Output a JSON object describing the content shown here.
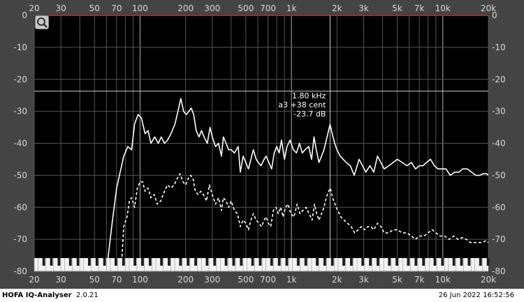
{
  "app": {
    "name": "HOFA IQ-Analyser",
    "version": "2.0.21",
    "timestamp": "26 Jun 2022 16:52:56"
  },
  "icons": {
    "zoom": "magnifier-icon"
  },
  "colors": {
    "background": "#000000",
    "frame": "#444444",
    "grid": "#7a7a7a",
    "curve": "#ffffff",
    "redline": "#cc2222"
  },
  "cursor": {
    "freq": "1.80 kHz",
    "note": "a3 +38 cent",
    "level": "-23.7 dB",
    "freq_hz": 1800,
    "level_db": -23.7
  },
  "chart_data": {
    "type": "line",
    "x_scale": "log",
    "xlim": [
      20,
      20000
    ],
    "ylim": [
      -80,
      0
    ],
    "x_ticks": [
      {
        "v": 20,
        "label": "20"
      },
      {
        "v": 30,
        "label": "30"
      },
      {
        "v": 50,
        "label": "50"
      },
      {
        "v": 70,
        "label": "70"
      },
      {
        "v": 100,
        "label": "100"
      },
      {
        "v": 200,
        "label": "200"
      },
      {
        "v": 300,
        "label": "300"
      },
      {
        "v": 500,
        "label": "500"
      },
      {
        "v": 700,
        "label": "700"
      },
      {
        "v": 1000,
        "label": "1k"
      },
      {
        "v": 2000,
        "label": "2k"
      },
      {
        "v": 3000,
        "label": "3k"
      },
      {
        "v": 5000,
        "label": "5k"
      },
      {
        "v": 7000,
        "label": "7k"
      },
      {
        "v": 10000,
        "label": "10k"
      },
      {
        "v": 20000,
        "label": "20k"
      }
    ],
    "y_ticks": [
      {
        "v": 0,
        "label": "0"
      },
      {
        "v": -10,
        "label": "-10"
      },
      {
        "v": -20,
        "label": "-20"
      },
      {
        "v": -30,
        "label": "-30"
      },
      {
        "v": -40,
        "label": "-40"
      },
      {
        "v": -50,
        "label": "-50"
      },
      {
        "v": -60,
        "label": "-60"
      },
      {
        "v": -70,
        "label": "-70"
      },
      {
        "v": -80,
        "label": "-80"
      }
    ],
    "grid": true,
    "series": [
      {
        "style": "solid",
        "points": [
          [
            60,
            -80
          ],
          [
            65,
            -66
          ],
          [
            70,
            -54
          ],
          [
            78,
            -44
          ],
          [
            83,
            -41
          ],
          [
            88,
            -42
          ],
          [
            92,
            -34
          ],
          [
            97,
            -31
          ],
          [
            102,
            -32
          ],
          [
            108,
            -37
          ],
          [
            113,
            -36
          ],
          [
            118,
            -40
          ],
          [
            125,
            -38
          ],
          [
            132,
            -40
          ],
          [
            138,
            -38
          ],
          [
            145,
            -40
          ],
          [
            152,
            -39
          ],
          [
            160,
            -37
          ],
          [
            170,
            -34
          ],
          [
            178,
            -30
          ],
          [
            186,
            -26
          ],
          [
            194,
            -30
          ],
          [
            202,
            -31
          ],
          [
            210,
            -30
          ],
          [
            218,
            -29
          ],
          [
            226,
            -31
          ],
          [
            235,
            -36
          ],
          [
            245,
            -38
          ],
          [
            255,
            -36
          ],
          [
            265,
            -38
          ],
          [
            278,
            -40
          ],
          [
            290,
            -35
          ],
          [
            300,
            -38
          ],
          [
            315,
            -41
          ],
          [
            330,
            -40
          ],
          [
            345,
            -44
          ],
          [
            355,
            -38
          ],
          [
            370,
            -40
          ],
          [
            385,
            -42
          ],
          [
            400,
            -42
          ],
          [
            420,
            -43
          ],
          [
            445,
            -41
          ],
          [
            460,
            -49
          ],
          [
            480,
            -44
          ],
          [
            500,
            -46
          ],
          [
            520,
            -48
          ],
          [
            540,
            -45
          ],
          [
            560,
            -42
          ],
          [
            585,
            -45
          ],
          [
            605,
            -46
          ],
          [
            630,
            -47
          ],
          [
            660,
            -45
          ],
          [
            680,
            -44
          ],
          [
            710,
            -46
          ],
          [
            740,
            -48
          ],
          [
            770,
            -43
          ],
          [
            800,
            -41
          ],
          [
            830,
            -43
          ],
          [
            860,
            -39
          ],
          [
            900,
            -45
          ],
          [
            935,
            -41
          ],
          [
            980,
            -39
          ],
          [
            1030,
            -42
          ],
          [
            1080,
            -43
          ],
          [
            1130,
            -40
          ],
          [
            1180,
            -43
          ],
          [
            1230,
            -42
          ],
          [
            1300,
            -41
          ],
          [
            1360,
            -45
          ],
          [
            1410,
            -38
          ],
          [
            1460,
            -42
          ],
          [
            1520,
            -46
          ],
          [
            1580,
            -44
          ],
          [
            1640,
            -42
          ],
          [
            1700,
            -39
          ],
          [
            1760,
            -36
          ],
          [
            1800,
            -34
          ],
          [
            1860,
            -37
          ],
          [
            1930,
            -40
          ],
          [
            2000,
            -42
          ],
          [
            2100,
            -44
          ],
          [
            2200,
            -45
          ],
          [
            2300,
            -46
          ],
          [
            2450,
            -47
          ],
          [
            2600,
            -50
          ],
          [
            2800,
            -45
          ],
          [
            2950,
            -47
          ],
          [
            3100,
            -49
          ],
          [
            3300,
            -47
          ],
          [
            3500,
            -49
          ],
          [
            3700,
            -44
          ],
          [
            3900,
            -46
          ],
          [
            4100,
            -48
          ],
          [
            4400,
            -47
          ],
          [
            4700,
            -46
          ],
          [
            5000,
            -45
          ],
          [
            5400,
            -46
          ],
          [
            5800,
            -47
          ],
          [
            6200,
            -46
          ],
          [
            6600,
            -48
          ],
          [
            7000,
            -47
          ],
          [
            7400,
            -47
          ],
          [
            7800,
            -46
          ],
          [
            8300,
            -45
          ],
          [
            8800,
            -47
          ],
          [
            9300,
            -48
          ],
          [
            9800,
            -48
          ],
          [
            10500,
            -48
          ],
          [
            11200,
            -50
          ],
          [
            12000,
            -49
          ],
          [
            12800,
            -49
          ],
          [
            13500,
            -48
          ],
          [
            14500,
            -48
          ],
          [
            15500,
            -49
          ],
          [
            16500,
            -50
          ],
          [
            17500,
            -50
          ],
          [
            18500,
            -49.5
          ],
          [
            19500,
            -49.5
          ],
          [
            20000,
            -50
          ]
        ]
      },
      {
        "style": "dashed",
        "points": [
          [
            75,
            -80
          ],
          [
            78,
            -66
          ],
          [
            82,
            -63
          ],
          [
            85,
            -58
          ],
          [
            88,
            -57
          ],
          [
            92,
            -60
          ],
          [
            96,
            -54
          ],
          [
            100,
            -52
          ],
          [
            104,
            -52
          ],
          [
            108,
            -55
          ],
          [
            113,
            -54
          ],
          [
            118,
            -57
          ],
          [
            124,
            -56
          ],
          [
            130,
            -59
          ],
          [
            137,
            -58
          ],
          [
            145,
            -55
          ],
          [
            152,
            -53
          ],
          [
            160,
            -54
          ],
          [
            168,
            -53
          ],
          [
            176,
            -51
          ],
          [
            184,
            -49.5
          ],
          [
            192,
            -52
          ],
          [
            200,
            -53
          ],
          [
            208,
            -51
          ],
          [
            216,
            -50
          ],
          [
            224,
            -51
          ],
          [
            232,
            -55
          ],
          [
            242,
            -56
          ],
          [
            252,
            -55
          ],
          [
            262,
            -56
          ],
          [
            275,
            -58
          ],
          [
            287,
            -53
          ],
          [
            300,
            -56
          ],
          [
            315,
            -59
          ],
          [
            330,
            -57
          ],
          [
            345,
            -61
          ],
          [
            355,
            -57
          ],
          [
            370,
            -58
          ],
          [
            385,
            -60
          ],
          [
            400,
            -58
          ],
          [
            420,
            -61
          ],
          [
            440,
            -62
          ],
          [
            460,
            -66
          ],
          [
            480,
            -64
          ],
          [
            500,
            -65
          ],
          [
            520,
            -67
          ],
          [
            540,
            -64
          ],
          [
            560,
            -62
          ],
          [
            585,
            -64
          ],
          [
            610,
            -65
          ],
          [
            635,
            -66
          ],
          [
            660,
            -64
          ],
          [
            680,
            -63
          ],
          [
            705,
            -65
          ],
          [
            730,
            -66
          ],
          [
            760,
            -61
          ],
          [
            790,
            -60
          ],
          [
            820,
            -62
          ],
          [
            850,
            -60
          ],
          [
            880,
            -63
          ],
          [
            915,
            -60
          ],
          [
            950,
            -59
          ],
          [
            990,
            -62
          ],
          [
            1040,
            -63
          ],
          [
            1090,
            -59
          ],
          [
            1140,
            -62
          ],
          [
            1190,
            -61
          ],
          [
            1250,
            -60
          ],
          [
            1310,
            -62
          ],
          [
            1370,
            -64
          ],
          [
            1420,
            -59
          ],
          [
            1470,
            -62
          ],
          [
            1520,
            -64
          ],
          [
            1580,
            -62
          ],
          [
            1640,
            -60
          ],
          [
            1700,
            -57
          ],
          [
            1760,
            -55
          ],
          [
            1810,
            -54
          ],
          [
            1870,
            -57
          ],
          [
            1940,
            -59
          ],
          [
            2020,
            -61
          ],
          [
            2120,
            -63
          ],
          [
            2230,
            -64
          ],
          [
            2350,
            -65
          ],
          [
            2480,
            -66
          ],
          [
            2620,
            -68
          ],
          [
            2760,
            -67
          ],
          [
            2900,
            -66
          ],
          [
            3050,
            -67
          ],
          [
            3200,
            -66
          ],
          [
            3350,
            -66
          ],
          [
            3500,
            -67
          ],
          [
            3700,
            -65
          ],
          [
            3900,
            -66
          ],
          [
            4100,
            -68
          ],
          [
            4400,
            -68
          ],
          [
            4700,
            -67
          ],
          [
            5000,
            -67
          ],
          [
            5400,
            -68
          ],
          [
            5800,
            -68
          ],
          [
            6200,
            -69
          ],
          [
            6600,
            -70
          ],
          [
            7000,
            -69
          ],
          [
            7500,
            -69
          ],
          [
            8000,
            -68
          ],
          [
            8500,
            -67
          ],
          [
            9000,
            -68
          ],
          [
            9600,
            -69
          ],
          [
            10300,
            -69
          ],
          [
            11000,
            -70
          ],
          [
            11800,
            -69
          ],
          [
            12600,
            -70
          ],
          [
            13400,
            -69.5
          ],
          [
            14300,
            -70
          ],
          [
            15200,
            -71
          ],
          [
            16200,
            -71
          ],
          [
            17200,
            -71
          ],
          [
            18200,
            -71
          ],
          [
            19200,
            -70.5
          ],
          [
            20000,
            -71
          ]
        ]
      }
    ]
  }
}
